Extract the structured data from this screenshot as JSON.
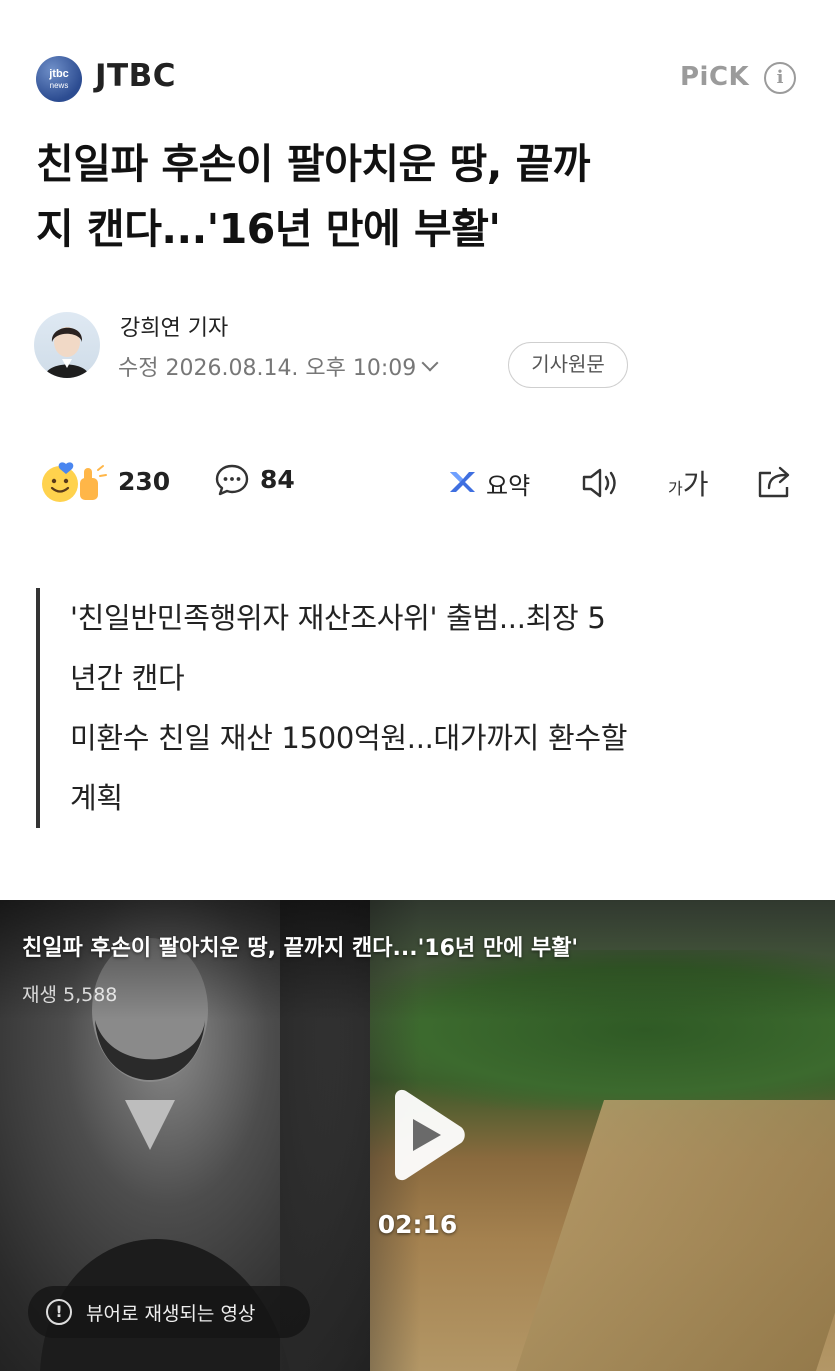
{
  "header": {
    "press_logo_text": "jtbc news",
    "press_name": "JTBC",
    "pick_label": "PiCK",
    "info_icon_glyph": "i"
  },
  "article": {
    "headline_line1": "친일파 후손이 팔아치운 땅, 끝까",
    "headline_line2": "지 캔다...'16년 만에 부활'",
    "reporter_name": "강희연 기자",
    "date_text": "수정 2026.08.14. 오후 10:09",
    "original_button": "기사원문"
  },
  "actions": {
    "reaction_count": "230",
    "comment_count": "84",
    "summary_label": "요약",
    "font_small": "가",
    "font_large": "가"
  },
  "summary": {
    "lines": [
      "'친일반민족행위자 재산조사위' 출범...최장 5",
      "년간 캔다",
      "미환수 친일 재산 1500억원...대가까지 환수할",
      "계획"
    ]
  },
  "video": {
    "title": "친일파 후손이 팔아치운 땅, 끝까지 캔다...'16년 만에 부활'",
    "views": "재생 5,588",
    "duration": "02:16",
    "viewer_notice": "뷰어로 재생되는 영상"
  },
  "colors": {
    "logo_blue": "#2c4c91",
    "muted_gray": "#9b9b9b",
    "summary_icon_blue": "#3f6fe0"
  }
}
